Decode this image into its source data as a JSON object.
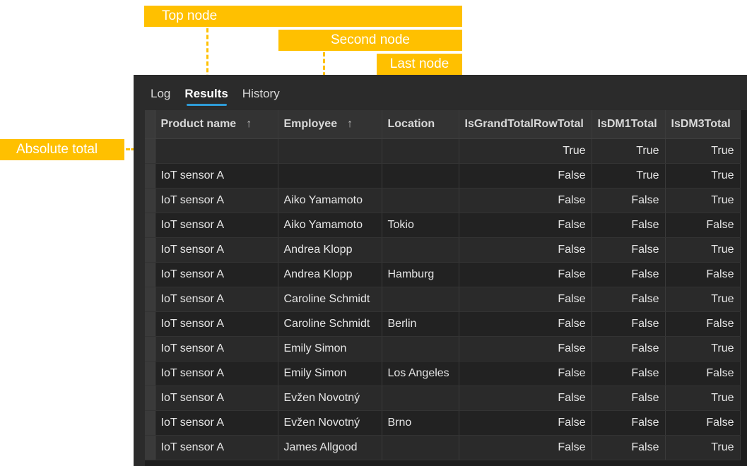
{
  "annotations": {
    "top_node": "Top node",
    "second_node": "Second node",
    "last_node": "Last node",
    "absolute_total": "Absolute total"
  },
  "tabs": [
    {
      "label": "Log",
      "active": false
    },
    {
      "label": "Results",
      "active": true
    },
    {
      "label": "History",
      "active": false
    }
  ],
  "grid": {
    "columns": [
      {
        "label": "Product name",
        "sorted": "asc"
      },
      {
        "label": "Employee",
        "sorted": "asc"
      },
      {
        "label": "Location"
      },
      {
        "label": "IsGrandTotalRowTotal"
      },
      {
        "label": "IsDM1Total"
      },
      {
        "label": "IsDM3Total"
      }
    ],
    "sort_icon": "arrow-up-icon",
    "rows": [
      [
        "",
        "",
        "",
        "True",
        "True",
        "True"
      ],
      [
        "IoT sensor A",
        "",
        "",
        "False",
        "True",
        "True"
      ],
      [
        "IoT sensor A",
        "Aiko Yamamoto",
        "",
        "False",
        "False",
        "True"
      ],
      [
        "IoT sensor A",
        "Aiko Yamamoto",
        "Tokio",
        "False",
        "False",
        "False"
      ],
      [
        "IoT sensor A",
        "Andrea Klopp",
        "",
        "False",
        "False",
        "True"
      ],
      [
        "IoT sensor A",
        "Andrea Klopp",
        "Hamburg",
        "False",
        "False",
        "False"
      ],
      [
        "IoT sensor A",
        "Caroline Schmidt",
        "",
        "False",
        "False",
        "True"
      ],
      [
        "IoT sensor A",
        "Caroline Schmidt",
        "Berlin",
        "False",
        "False",
        "False"
      ],
      [
        "IoT sensor A",
        "Emily Simon",
        "",
        "False",
        "False",
        "True"
      ],
      [
        "IoT sensor A",
        "Emily Simon",
        "Los Angeles",
        "False",
        "False",
        "False"
      ],
      [
        "IoT sensor A",
        "Evžen Novotný",
        "",
        "False",
        "False",
        "True"
      ],
      [
        "IoT sensor A",
        "Evžen Novotný",
        "Brno",
        "False",
        "False",
        "False"
      ],
      [
        "IoT sensor A",
        "James Allgood",
        "",
        "False",
        "False",
        "True"
      ]
    ]
  },
  "colors": {
    "callout": "#ffc000",
    "panel": "#2b2b2b",
    "tab_underline": "#2e9bd6"
  }
}
